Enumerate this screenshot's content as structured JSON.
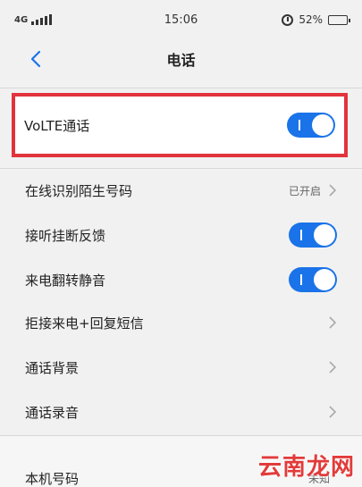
{
  "status_bar": {
    "network": "4G",
    "time": "15:06",
    "battery": "52%"
  },
  "header": {
    "title": "电话",
    "back_icon": "chevron-left-icon"
  },
  "settings": [
    {
      "label": "VoLTE通话",
      "control": "toggle",
      "on": true,
      "highlighted": true
    },
    {
      "label": "在线识别陌生号码",
      "value": "已开启",
      "control": "chevron"
    },
    {
      "label": "接听挂断反馈",
      "control": "toggle",
      "on": true
    },
    {
      "label": "来电翻转静音",
      "control": "toggle",
      "on": true
    },
    {
      "label": "拒接来电+回复短信",
      "control": "chevron"
    },
    {
      "label": "通话背景",
      "control": "chevron"
    },
    {
      "label": "通话录音",
      "control": "chevron"
    },
    {
      "label": "本机号码",
      "value": "未知",
      "control": "chevron"
    }
  ],
  "watermark": "云南龙网",
  "colors": {
    "toggle_on": "#1a73e8",
    "highlight_border": "#e2333c",
    "watermark": "#e23b3b"
  }
}
